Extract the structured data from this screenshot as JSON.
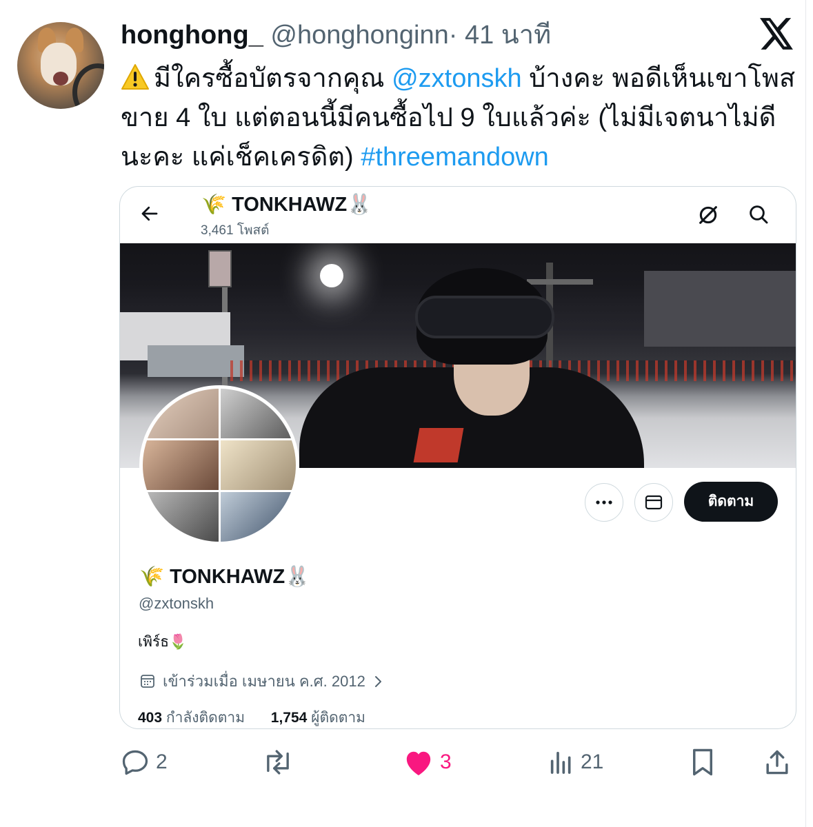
{
  "tweet": {
    "author_name": "honghong_",
    "author_handle": "@honghonginn",
    "separator": "·",
    "time": "41 นาที",
    "text_part1": "มีใครซื้อบัตรจากคุณ ",
    "mention": "@zxtonskh",
    "text_part2": " บ้างคะ พอดีเห็นเขาโพสขาย 4 ใบ แต่ตอนนี้มีคนซื้อไป 9 ใบแล้วค่ะ (ไม่มีเจตนาไม่ดีนะคะ แค่เช็คเครดิต) ",
    "hashtag": "#threemandown"
  },
  "embedded_profile": {
    "header_name": "🌾 TONKHAWZ🐰",
    "post_count": "3,461 โพสต์",
    "follow_label": "ติดตาม",
    "display_name": "🌾 TONKHAWZ🐰",
    "handle": "@zxtonskh",
    "bio": "เพิร์ธ🌷",
    "joined": "เข้าร่วมเมื่อ เมษายน ค.ศ. 2012",
    "following_count": "403",
    "following_label": "กำลังติดตาม",
    "followers_count": "1,754",
    "followers_label": "ผู้ติดตาม"
  },
  "actions": {
    "replies": "2",
    "likes": "3",
    "views": "21"
  },
  "colors": {
    "link": "#1d9bf0",
    "like": "#f91880",
    "secondary_text": "#536471"
  },
  "icons": [
    "x-logo-icon",
    "warning-icon",
    "back-arrow-icon",
    "grok-icon",
    "search-icon",
    "more-icon",
    "mail-icon",
    "calendar-icon",
    "chevron-right-icon",
    "reply-icon",
    "retweet-icon",
    "heart-icon",
    "views-icon",
    "bookmark-icon",
    "share-icon"
  ]
}
